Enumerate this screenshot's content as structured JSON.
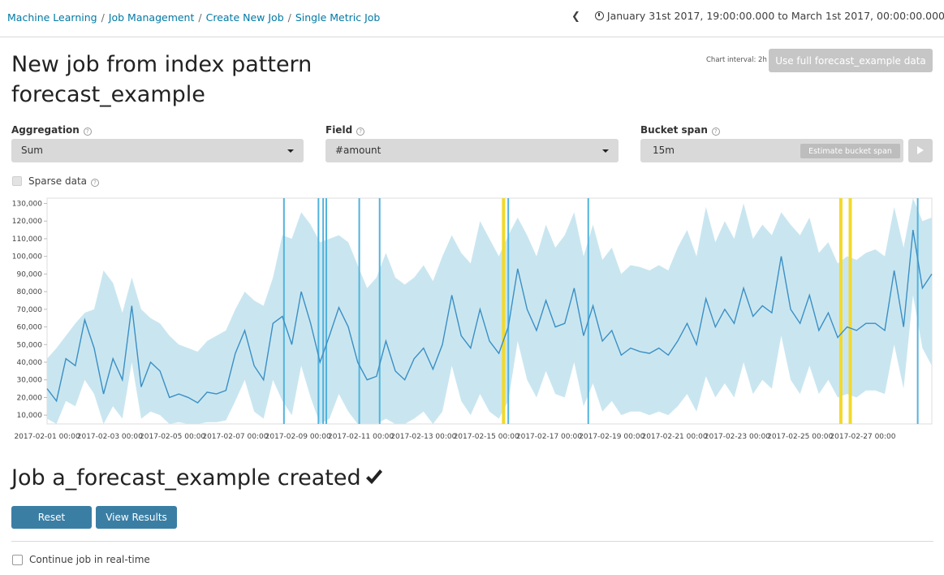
{
  "breadcrumbs": [
    "Machine Learning",
    "Job Management",
    "Create New Job",
    "Single Metric Job"
  ],
  "timepicker": {
    "from": "January 31st 2017, 19:00:00.000",
    "to_word": "to",
    "to": "March 1st 2017, 00:00:00.000"
  },
  "page_title": "New job from index pattern forecast_example",
  "chart_interval": "Chart interval: 2h",
  "use_full_button": "Use full forecast_example data",
  "aggregation": {
    "label": "Aggregation",
    "value": "Sum"
  },
  "field": {
    "label": "Field",
    "value": "#amount"
  },
  "bucket_span": {
    "label": "Bucket span",
    "value": "15m",
    "estimate_button": "Estimate bucket span"
  },
  "sparse_label": "Sparse data",
  "job_created": "Job a_forecast_example created",
  "buttons": {
    "reset": "Reset",
    "view_results": "View Results"
  },
  "realtime_label": "Continue job in real-time",
  "colors": {
    "line": "#3b8fc5",
    "band": "#c9e6f0",
    "anomaly_blue": "#52b3dd",
    "anomaly_yellow": "#f2d92b",
    "button": "#3b7ea4",
    "link": "#0079a5"
  },
  "chart_data": {
    "type": "line",
    "y_ticks": [
      "130,000",
      "120,000",
      "110,000",
      "100,000",
      "90,000",
      "80,000",
      "70,000",
      "60,000",
      "50,000",
      "40,000",
      "30,000",
      "20,000",
      "10,000"
    ],
    "x_ticks": [
      "2017-02-01 00:00",
      "2017-02-03 00:00",
      "2017-02-05 00:00",
      "2017-02-07 00:00",
      "2017-02-09 00:00",
      "2017-02-11 00:00",
      "2017-02-13 00:00",
      "2017-02-15 00:00",
      "2017-02-17 00:00",
      "2017-02-19 00:00",
      "2017-02-21 00:00",
      "2017-02-23 00:00",
      "2017-02-25 00:00",
      "2017-02-27 00:00"
    ],
    "ylim": [
      5000,
      133000
    ],
    "xlim_days": [
      0,
      28.2
    ],
    "series": [
      {
        "values_days": [
          0,
          0.3,
          0.6,
          0.9,
          1.2,
          1.5,
          1.8,
          2.1,
          2.4,
          2.7,
          3.0,
          3.3,
          3.6,
          3.9,
          4.2,
          4.5,
          4.8,
          5.1,
          5.4,
          5.7,
          6.0,
          6.3,
          6.6,
          6.9,
          7.2,
          7.5,
          7.8,
          8.1,
          8.4,
          8.7,
          9.0,
          9.3,
          9.6,
          9.9,
          10.2,
          10.5,
          10.8,
          11.1,
          11.4,
          11.7,
          12.0,
          12.3,
          12.6,
          12.9,
          13.2,
          13.5,
          13.8,
          14.1,
          14.4,
          14.7,
          15.0,
          15.3,
          15.6,
          15.9,
          16.2,
          16.5,
          16.8,
          17.1,
          17.4,
          17.7,
          18.0,
          18.3,
          18.6,
          18.9,
          19.2,
          19.5,
          19.8,
          20.1,
          20.4,
          20.7,
          21.0,
          21.3,
          21.6,
          21.9,
          22.2,
          22.5,
          22.8,
          23.1,
          23.4,
          23.7,
          24.0,
          24.3,
          24.6,
          24.9,
          25.2,
          25.5,
          25.8,
          26.1,
          26.4,
          26.7,
          27.0,
          27.3,
          27.6,
          27.9,
          28.2
        ],
        "values": [
          25000,
          18000,
          42000,
          38000,
          64000,
          48000,
          22000,
          42000,
          30000,
          72000,
          26000,
          40000,
          35000,
          20000,
          22000,
          20000,
          17000,
          23000,
          22000,
          24000,
          45000,
          58000,
          38000,
          30000,
          62000,
          66000,
          50000,
          80000,
          62000,
          40000,
          55000,
          71000,
          60000,
          40000,
          30000,
          32000,
          52000,
          35000,
          30000,
          42000,
          48000,
          36000,
          50000,
          78000,
          55000,
          48000,
          70000,
          52000,
          45000,
          60000,
          93000,
          70000,
          58000,
          75000,
          60000,
          62000,
          82000,
          55000,
          72000,
          52000,
          58000,
          44000,
          48000,
          46000,
          45000,
          48000,
          44000,
          52000,
          62000,
          50000,
          76000,
          60000,
          70000,
          62000,
          82000,
          66000,
          72000,
          68000,
          100000,
          70000,
          62000,
          78000,
          58000,
          68000,
          54000,
          60000,
          58000,
          62000,
          62000,
          58000,
          92000,
          60000,
          115000,
          82000,
          90000
        ]
      }
    ],
    "upper_band": [
      42000,
      48000,
      55000,
      62000,
      68000,
      70000,
      92000,
      85000,
      68000,
      88000,
      70000,
      65000,
      62000,
      55000,
      50000,
      48000,
      46000,
      52000,
      55000,
      58000,
      70000,
      80000,
      75000,
      72000,
      88000,
      112000,
      110000,
      125000,
      118000,
      108000,
      110000,
      112000,
      108000,
      95000,
      82000,
      88000,
      102000,
      88000,
      84000,
      88000,
      95000,
      86000,
      100000,
      112000,
      102000,
      96000,
      120000,
      110000,
      100000,
      112000,
      122000,
      112000,
      100000,
      118000,
      105000,
      112000,
      125000,
      100000,
      118000,
      98000,
      105000,
      90000,
      95000,
      94000,
      92000,
      95000,
      92000,
      105000,
      115000,
      100000,
      128000,
      108000,
      120000,
      110000,
      130000,
      110000,
      118000,
      112000,
      125000,
      118000,
      112000,
      122000,
      102000,
      108000,
      96000,
      100000,
      98000,
      102000,
      104000,
      100000,
      128000,
      105000,
      140000,
      120000,
      122000
    ],
    "lower_band": [
      8000,
      5000,
      18000,
      15000,
      30000,
      22000,
      5000,
      15000,
      8000,
      40000,
      8000,
      12000,
      10000,
      5000,
      6000,
      5000,
      5000,
      6000,
      6000,
      7000,
      18000,
      30000,
      12000,
      8000,
      30000,
      18000,
      10000,
      38000,
      20000,
      5000,
      8000,
      22000,
      12000,
      5000,
      5000,
      5000,
      8000,
      5000,
      5000,
      8000,
      12000,
      5000,
      12000,
      38000,
      18000,
      10000,
      22000,
      12000,
      8000,
      18000,
      52000,
      30000,
      20000,
      35000,
      22000,
      20000,
      40000,
      15000,
      28000,
      12000,
      18000,
      10000,
      12000,
      12000,
      10000,
      12000,
      10000,
      15000,
      22000,
      12000,
      32000,
      20000,
      28000,
      20000,
      40000,
      22000,
      30000,
      25000,
      55000,
      30000,
      22000,
      38000,
      22000,
      30000,
      20000,
      22000,
      20000,
      24000,
      24000,
      22000,
      50000,
      25000,
      78000,
      48000,
      38000
    ],
    "anomaly_markers_days": [
      {
        "d": 7.55,
        "c": "blue"
      },
      {
        "d": 8.65,
        "c": "blue"
      },
      {
        "d": 8.8,
        "c": "blue"
      },
      {
        "d": 8.9,
        "c": "blue"
      },
      {
        "d": 9.95,
        "c": "blue"
      },
      {
        "d": 10.6,
        "c": "blue"
      },
      {
        "d": 14.55,
        "c": "yellow"
      },
      {
        "d": 14.7,
        "c": "blue"
      },
      {
        "d": 17.25,
        "c": "blue"
      },
      {
        "d": 25.3,
        "c": "yellow"
      },
      {
        "d": 25.6,
        "c": "yellow"
      },
      {
        "d": 27.75,
        "c": "blue"
      }
    ]
  }
}
